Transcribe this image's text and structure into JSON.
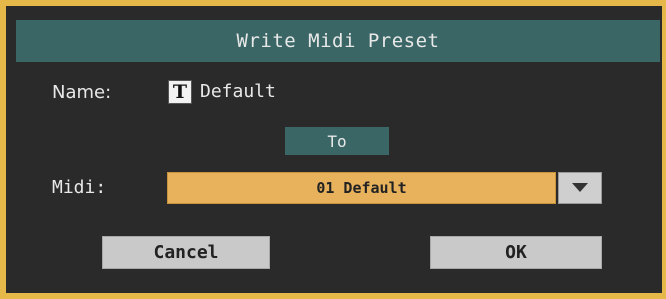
{
  "dialog": {
    "title": "Write Midi Preset",
    "name_label": "Name:",
    "name_icon": "T",
    "name_value": "Default",
    "to_label": "To",
    "midi_label": "Midi:",
    "midi_selected": "01 Default",
    "cancel_label": "Cancel",
    "ok_label": "OK"
  },
  "colors": {
    "frame": "#e6b84a",
    "background": "#2a2a2a",
    "title_bar": "#3a6666",
    "select_fill": "#e8b25d",
    "button_fill": "#c9c9c9"
  },
  "icons": {
    "text_edit": "text-edit-icon",
    "dropdown": "chevron-down-icon"
  }
}
